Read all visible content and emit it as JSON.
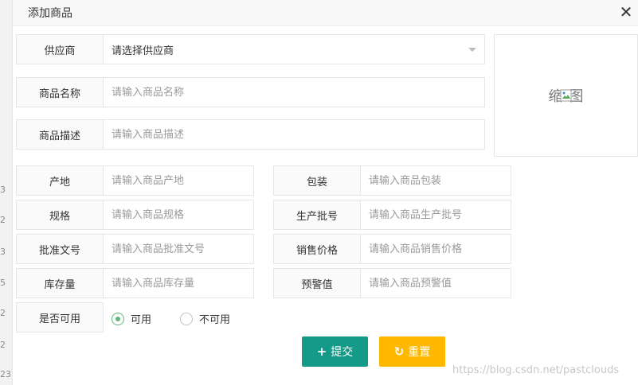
{
  "dialog": {
    "title": "添加商品"
  },
  "supplier": {
    "label": "供应商",
    "selected": "请选择供应商"
  },
  "fields": {
    "name": {
      "label": "商品名称",
      "placeholder": "请输入商品名称"
    },
    "desc": {
      "label": "商品描述",
      "placeholder": "请输入商品描述"
    },
    "origin": {
      "label": "产地",
      "placeholder": "请输入商品产地"
    },
    "pack": {
      "label": "包装",
      "placeholder": "请输入商品包装"
    },
    "spec": {
      "label": "规格",
      "placeholder": "请输入商品规格"
    },
    "batch": {
      "label": "生产批号",
      "placeholder": "请输入商品生产批号"
    },
    "approval": {
      "label": "批准文号",
      "placeholder": "请输入商品批准文号"
    },
    "price": {
      "label": "销售价格",
      "placeholder": "请输入商品销售价格"
    },
    "stock": {
      "label": "库存量",
      "placeholder": "请输入商品库存量"
    },
    "warn": {
      "label": "预警值",
      "placeholder": "请输入商品预警值"
    }
  },
  "thumbnail": {
    "alt_before": "缩",
    "alt_after": "图"
  },
  "available": {
    "label": "是否可用",
    "options": [
      "可用",
      "不可用"
    ],
    "selected": "可用"
  },
  "buttons": {
    "submit": "提交",
    "reset": "重置"
  },
  "watermark": "https://blog.csdn.net/pastclouds",
  "background_strip": [
    "3",
    "2",
    "3",
    "5",
    "2",
    "2",
    "23"
  ]
}
